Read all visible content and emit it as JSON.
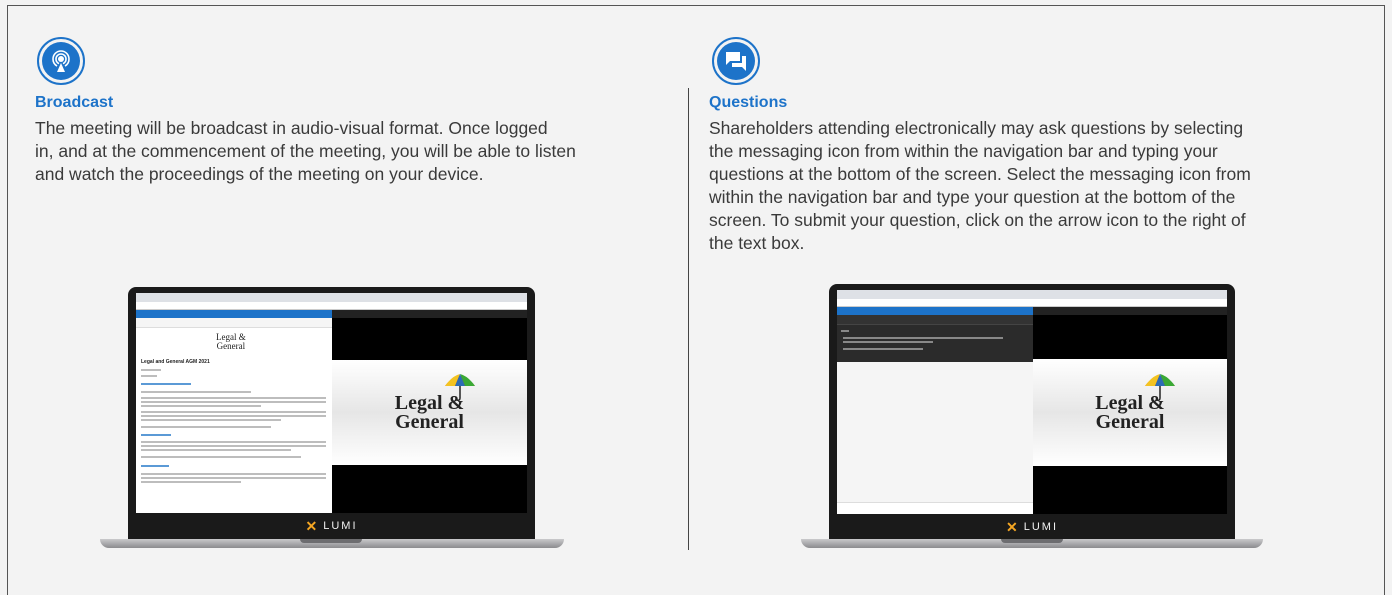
{
  "broadcast": {
    "icon": "broadcast-icon",
    "title": "Broadcast",
    "lines": [
      "The meeting will be broadcast in audio-visual format. Once logged",
      "in, and at the commencement of the meeting, you will be able to listen",
      "and watch the proceedings of the meeting on your device."
    ],
    "laptop_brand": "LUMI",
    "company_logo": [
      "Legal &",
      "General"
    ],
    "meeting_heading": "Legal and General AGM 2021"
  },
  "questions": {
    "icon": "message-icon",
    "title": "Questions",
    "lines": [
      "Shareholders attending electronically may ask questions by selecting",
      "the messaging icon from within the navigation bar and typing your",
      "questions at the bottom of the screen. Select the messaging icon from",
      "within the navigation bar and type your question at the bottom of the",
      "screen. To submit your question, click on the arrow icon to the right of",
      "the text box."
    ],
    "laptop_brand": "LUMI",
    "company_logo": [
      "Legal &",
      "General"
    ]
  },
  "colors": {
    "accent": "#1d73c9",
    "text": "#3a3a3a",
    "lumi_x": "#f5a623"
  }
}
